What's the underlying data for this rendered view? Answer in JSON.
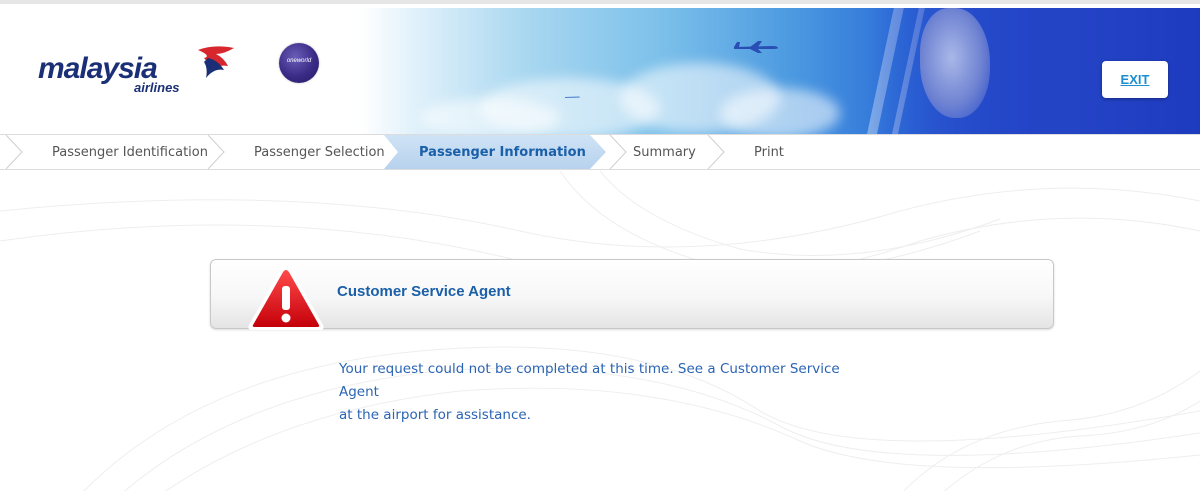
{
  "header": {
    "logo": {
      "name": "malaysia",
      "sub": "airlines"
    },
    "alliance_badge": "oneworld",
    "exit_label": "EXIT"
  },
  "steps": [
    {
      "label": "Passenger Identification",
      "active": false
    },
    {
      "label": "Passenger Selection",
      "active": false
    },
    {
      "label": "Passenger Information",
      "active": true
    },
    {
      "label": "Summary",
      "active": false
    },
    {
      "label": "Print",
      "active": false
    }
  ],
  "alert": {
    "icon": "warning-icon",
    "title": "Customer Service Agent",
    "message_line1": "Your request could not be completed at this time. See a Customer Service Agent",
    "message_line2": "at the airport for assistance."
  },
  "colors": {
    "brand_navy": "#1a2f75",
    "accent_blue": "#1a5fa8",
    "link_blue": "#1b8fcf",
    "active_step": "#b7d2ee",
    "warning_red": "#e0141b"
  }
}
